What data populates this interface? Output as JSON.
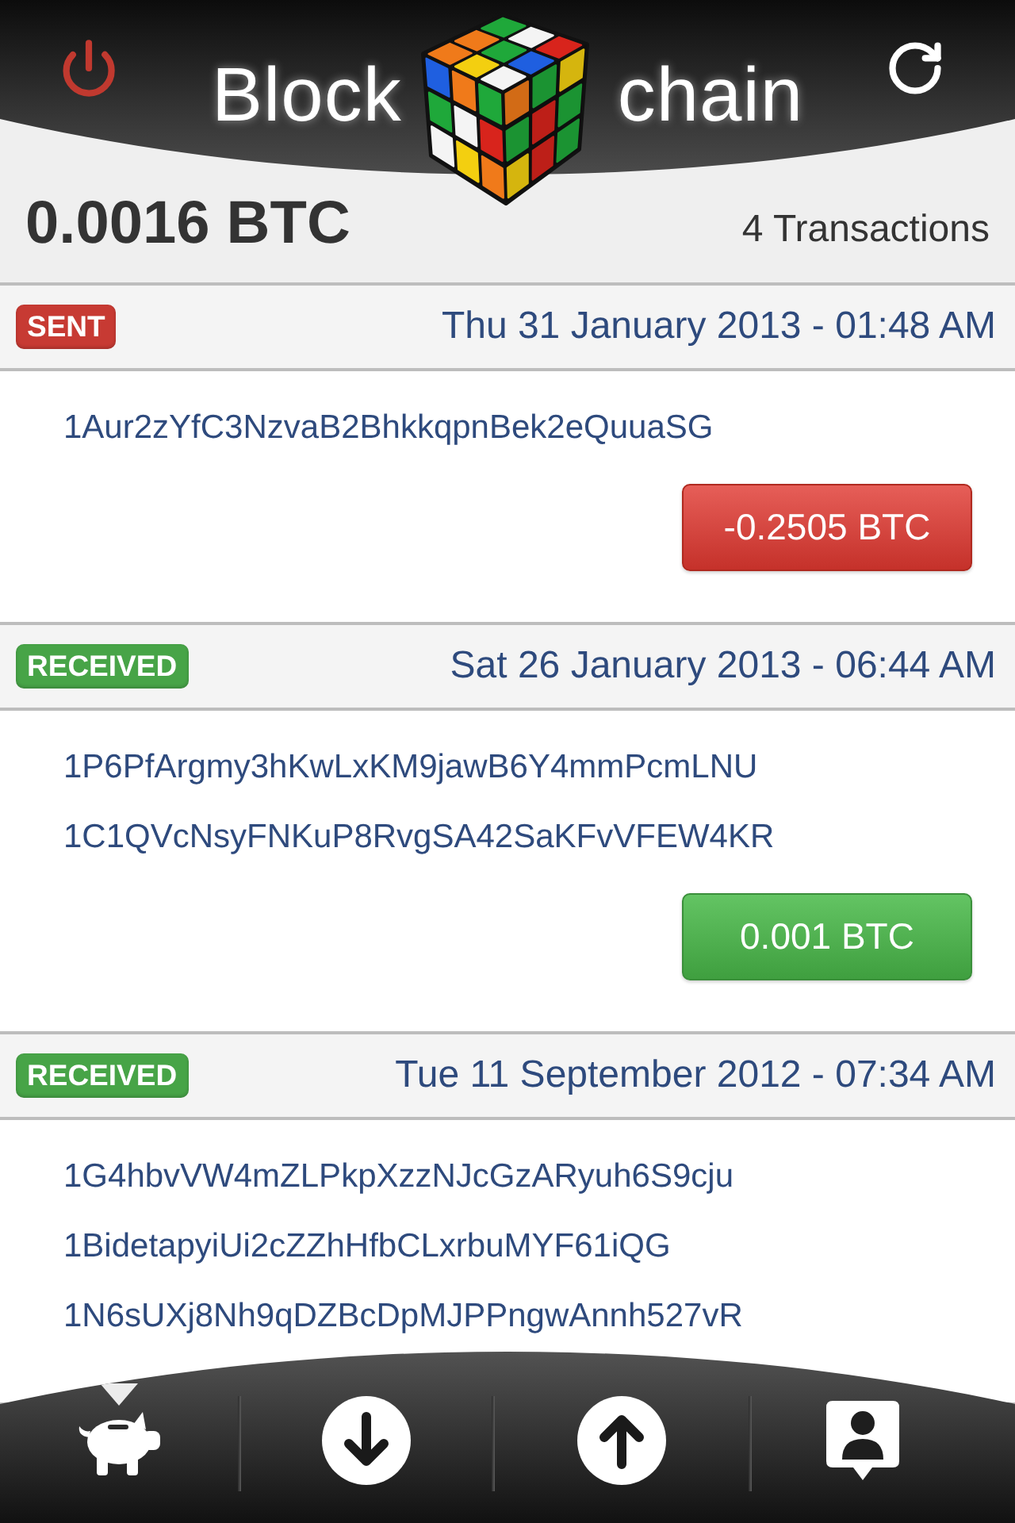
{
  "header": {
    "logo_left": "Block",
    "logo_right": "chain"
  },
  "balance": {
    "amount": "0.0016 BTC",
    "count": "4 Transactions"
  },
  "transactions": [
    {
      "kind": "sent",
      "badge": "SENT",
      "date": "Thu 31 January 2013 - 01:48 AM",
      "addresses": [
        "1Aur2zYfC3NzvaB2BhkkqpnBek2eQuuaSG"
      ],
      "amount": "-0.2505 BTC"
    },
    {
      "kind": "received",
      "badge": "RECEIVED",
      "date": "Sat 26 January 2013 - 06:44 AM",
      "addresses": [
        "1P6PfArgmy3hKwLxKM9jawB6Y4mmPcmLNU",
        "1C1QVcNsyFNKuP8RvgSA42SaKFvVFEW4KR"
      ],
      "amount": "0.001 BTC"
    },
    {
      "kind": "received",
      "badge": "RECEIVED",
      "date": "Tue 11 September 2012 - 07:34 AM",
      "addresses": [
        "1G4hbvVW4mZLPkpXzzNJcGzARyuh6S9cju",
        "1BidetapyiUi2cZZhHfbCLxrbuMYF61iQG",
        "1N6sUXj8Nh9qDZBcDpMJPPngwAnnh527vR"
      ]
    }
  ],
  "tab_bar": {
    "tabs": [
      {
        "kind": "piggy",
        "selected": true
      },
      {
        "kind": "down",
        "selected": false
      },
      {
        "kind": "up",
        "selected": false
      },
      {
        "kind": "contact",
        "selected": false
      }
    ]
  }
}
